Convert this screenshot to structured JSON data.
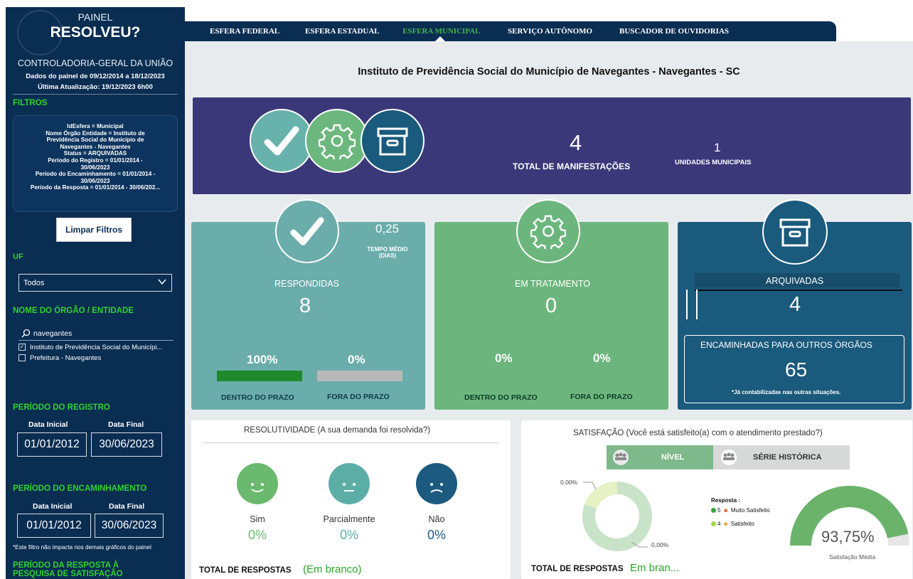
{
  "sidebar": {
    "brand_line1": "PAINEL",
    "brand_line2": "RESOLVEU?",
    "org": "CONTROLADORIA-GERAL DA UNIÃO",
    "dates_line1": "Dados do painel de 09/12/2014 a 18/12/2023",
    "dates_line2": "Última Atualização: 19/12/2023 6h00",
    "filters_heading": "FILTROS",
    "filter_lines": [
      "IdEsfera = Municipal",
      "Nome Órgão Entidade = Instituto de",
      "Previdência Social do Município de",
      "Navegantes - Navegantes",
      "Status = ARQUIVADAS",
      "Período do Registro = 01/01/2014 -",
      "30/06/2023",
      "Período do Encaminhamento = 01/01/2014 -",
      "30/06/2023",
      "Período da Resposta = 01/01/2014 - 30/06/202..."
    ],
    "clear_button": "Limpar Filtros",
    "uf_label": "UF",
    "uf_value": "Todos",
    "orgao_label": "NOME DO ÓRGÃO / ENTIDADE",
    "search_value": "navegantes",
    "orgao_options": [
      {
        "label": "Instituto de Previdência Social do Municípi...",
        "checked": true
      },
      {
        "label": "Prefeitura - Navegantes",
        "checked": false
      }
    ],
    "registro_label": "PERÍODO DO REGISTRO",
    "encaminhamento_label": "PERÍODO DO ENCAMINHAMENTO",
    "resposta_label": "PERÍODO DA RESPOSTA À PESQUISA DE SATISFAÇÃO",
    "data_inicial_label": "Data Inicial",
    "data_final_label": "Data Final",
    "registro_inicial": "01/01/2012",
    "registro_final": "30/06/2023",
    "encaminhamento_inicial": "01/01/2012",
    "encaminhamento_final": "30/06/2023",
    "note": "*Este filtro não impacta nos demais gráficos do painel"
  },
  "nav": {
    "tabs": [
      "ESFERA FEDERAL",
      "ESFERA ESTADUAL",
      "ESFERA MUNICIPAL",
      "SERVIÇO AUTÔNOMO",
      "BUSCADOR DE OUVIDORIAS"
    ],
    "active_index": 2
  },
  "main": {
    "title": "Instituto de Previdência Social do Município de Navegantes - Navegantes - SC",
    "banner": {
      "total_value": "4",
      "total_label": "TOTAL DE MANIFESTAÇÕES",
      "units_value": "1",
      "units_label": "UNIDADES MUNICIPAIS"
    },
    "respondidas": {
      "label": "RESPONDIDAS",
      "value": "8",
      "tempo_value": "0,25",
      "tempo_label1": "TEMPO MÉDIO",
      "tempo_label2": "(DIAS)",
      "dentro_pct": "100%",
      "fora_pct": "0%",
      "dentro_fraction": 1.0,
      "fora_fraction": 0.0,
      "dentro_label": "DENTRO DO PRAZO",
      "fora_label": "FORA DO PRAZO"
    },
    "tratamento": {
      "label": "EM TRATAMENTO",
      "value": "0",
      "dentro_pct": "0%",
      "fora_pct": "0%",
      "dentro_label": "DENTRO DO PRAZO",
      "fora_label": "FORA DO PRAZO"
    },
    "arquivadas": {
      "label": "ARQUIVADAS",
      "value": "4",
      "enc_label": "ENCAMINHADAS PARA OUTROS ÓRGÃOS",
      "enc_value": "65",
      "enc_note": "*Já contabilizadas nas outras situações."
    },
    "resolutividade": {
      "title": "RESOLUTIVIDADE (A sua demanda foi resolvida?)",
      "items": [
        {
          "label": "Sim",
          "pct": "0%",
          "color": "#6bb86f"
        },
        {
          "label": "Parcialmente",
          "pct": "0%",
          "color": "#5dada7"
        },
        {
          "label": "Não",
          "pct": "0%",
          "color": "#1c5a80"
        }
      ],
      "total_label": "TOTAL DE RESPOSTAS",
      "total_value": "(Em branco)"
    },
    "satisfacao": {
      "title": "SATISFAÇÃO (Você está satisfeito(a) com o atendimento prestado?)",
      "tab_nivel": "NÍVEL",
      "tab_serie": "SÉRIE HISTÓRICA",
      "donut_label_top": "0,00%",
      "donut_label_bottom": "0,00%",
      "legend_title": "Resposta :",
      "legend": [
        {
          "label": "5",
          "text": "Muito Satisfeito",
          "color": "#3aa63f"
        },
        {
          "label": "4",
          "text": "Satisfeito",
          "color": "#a7d44a"
        }
      ],
      "gauge_value": "93,75%",
      "gauge_fraction": 0.9375,
      "gauge_label": "Satisfação Média",
      "total_label": "TOTAL DE RESPOSTAS",
      "total_value": "Em bran..."
    }
  }
}
